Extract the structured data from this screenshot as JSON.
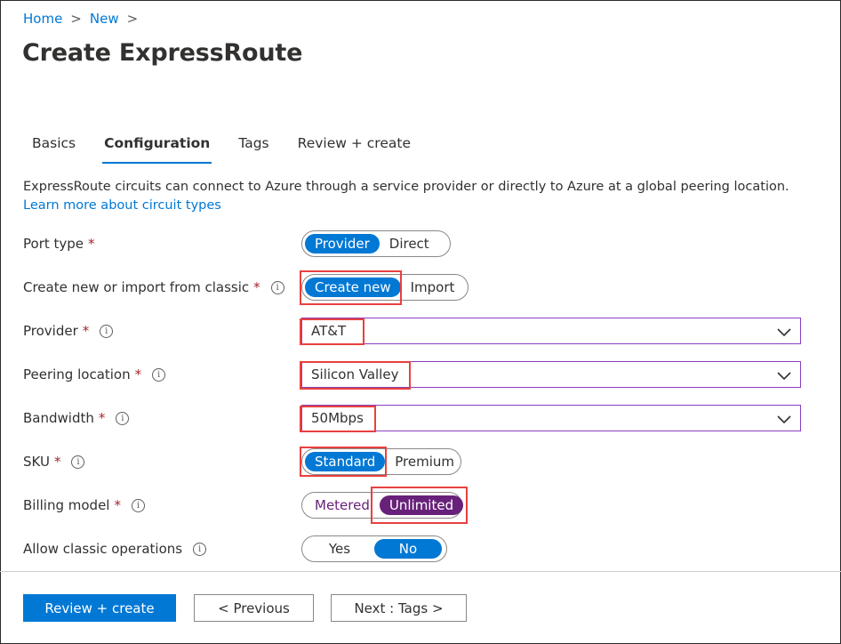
{
  "breadcrumb": {
    "home": "Home",
    "new": "New",
    "separator": ">"
  },
  "page_title": "Create ExpressRoute",
  "tabs": [
    {
      "label": "Basics",
      "active": false
    },
    {
      "label": "Configuration",
      "active": true
    },
    {
      "label": "Tags",
      "active": false
    },
    {
      "label": "Review + create",
      "active": false
    }
  ],
  "description": {
    "text": "ExpressRoute circuits can connect to Azure through a service provider or directly to Azure at a global peering location.",
    "link": "Learn more about circuit types"
  },
  "required_mark": "*",
  "info_glyph": "i",
  "fields": {
    "port_type": {
      "label": "Port type",
      "options": [
        "Provider",
        "Direct"
      ],
      "selected": "Provider"
    },
    "create_or_import": {
      "label": "Create new or import from classic",
      "options": [
        "Create new",
        "Import"
      ],
      "selected": "Create new"
    },
    "provider": {
      "label": "Provider",
      "value": "AT&T"
    },
    "peering_location": {
      "label": "Peering location",
      "value": "Silicon Valley"
    },
    "bandwidth": {
      "label": "Bandwidth",
      "value": "50Mbps"
    },
    "sku": {
      "label": "SKU",
      "options": [
        "Standard",
        "Premium"
      ],
      "selected": "Standard"
    },
    "billing_model": {
      "label": "Billing model",
      "options": [
        "Metered",
        "Unlimited"
      ],
      "selected": "Unlimited"
    },
    "allow_classic": {
      "label": "Allow classic operations",
      "options": [
        "Yes",
        "No"
      ],
      "selected": "No"
    }
  },
  "buttons": {
    "review_create": "Review + create",
    "previous": "< Previous",
    "next": "Next : Tags >"
  },
  "colors": {
    "accent": "#0078d4",
    "billing_selected": "#68217a",
    "highlight": "#e8413e",
    "required": "#a4262c",
    "dropdown_border": "#8a3fbf"
  }
}
